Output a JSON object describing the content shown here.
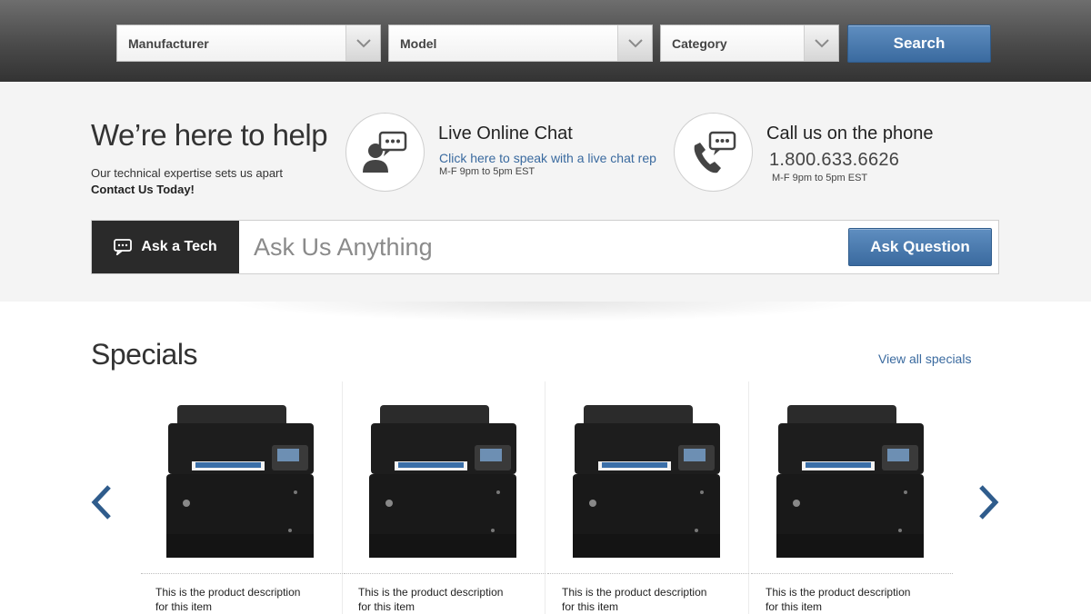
{
  "search_bar": {
    "manufacturer": "Manufacturer",
    "model": "Model",
    "category": "Category",
    "search_label": "Search"
  },
  "help": {
    "title": "We’re here to help",
    "subtitle": "Our technical expertise sets us apart",
    "cta": "Contact Us Today!",
    "chat": {
      "title": "Live Online Chat",
      "link": "Click here to speak with a live chat rep",
      "hours": "M-F 9pm to 5pm EST"
    },
    "phone": {
      "title": "Call us on the phone",
      "number": "1.800.633.6626",
      "hours": "M-F 9pm to 5pm EST"
    },
    "ask": {
      "tab_label": "Ask a Tech",
      "placeholder": "Ask Us Anything",
      "button_label": "Ask Question"
    }
  },
  "specials": {
    "title": "Specials",
    "view_all": "View all specials",
    "items": [
      {
        "desc_line1": "This is the product description",
        "desc_line2": "for this item"
      },
      {
        "desc_line1": "This is the product description",
        "desc_line2": "for this item"
      },
      {
        "desc_line1": "This is the product description",
        "desc_line2": "for this item"
      },
      {
        "desc_line1": "This is the product description",
        "desc_line2": "for this item"
      }
    ]
  },
  "colors": {
    "accent_blue": "#3a6a9f",
    "dark_tab": "#2a2a2a",
    "band_bg": "#f4f4f4"
  },
  "icons": {
    "chat": "chat-agent-icon",
    "phone": "phone-chat-icon",
    "carousel_prev": "chevron-left-icon",
    "carousel_next": "chevron-right-icon"
  }
}
